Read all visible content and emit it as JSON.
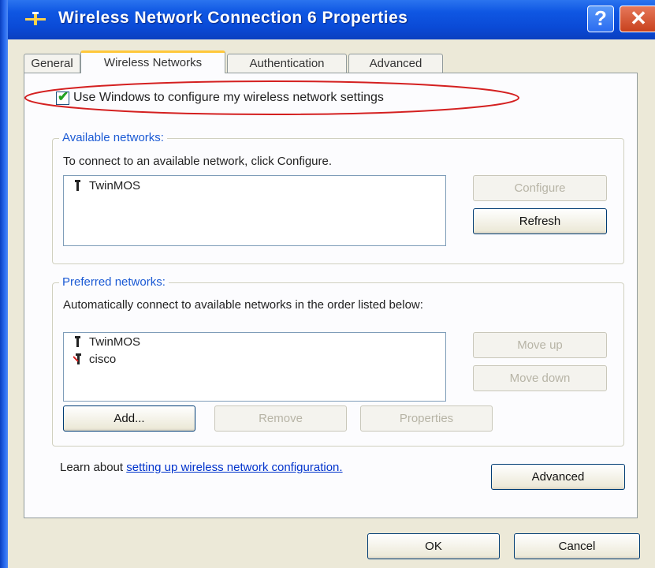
{
  "window": {
    "title": "Wireless Network Connection 6 Properties",
    "help_label": "?",
    "close_label": "✕"
  },
  "tabs": [
    {
      "label": "General"
    },
    {
      "label": "Wireless Networks"
    },
    {
      "label": "Authentication"
    },
    {
      "label": "Advanced"
    }
  ],
  "use_windows": {
    "label": "Use Windows to configure my wireless network settings",
    "checked": true
  },
  "available": {
    "title": "Available networks:",
    "description": "To connect to an available network, click Configure.",
    "networks": [
      "TwinMOS"
    ],
    "configure_label": "Configure",
    "refresh_label": "Refresh"
  },
  "preferred": {
    "title": "Preferred networks:",
    "description": "Automatically connect to available networks in the order listed below:",
    "networks": [
      "TwinMOS",
      "cisco"
    ],
    "move_up_label": "Move up",
    "move_down_label": "Move down",
    "add_label": "Add...",
    "remove_label": "Remove",
    "properties_label": "Properties"
  },
  "learn": {
    "prefix": "Learn about ",
    "link_text": "setting up wireless network configuration.",
    "advanced_label": "Advanced"
  },
  "footer": {
    "ok_label": "OK",
    "cancel_label": "Cancel"
  },
  "colors": {
    "title_bar": "#0a4ad6",
    "group_title": "#1b5ad4",
    "highlight_ellipse": "#d42020",
    "check_mark": "#21a121"
  }
}
